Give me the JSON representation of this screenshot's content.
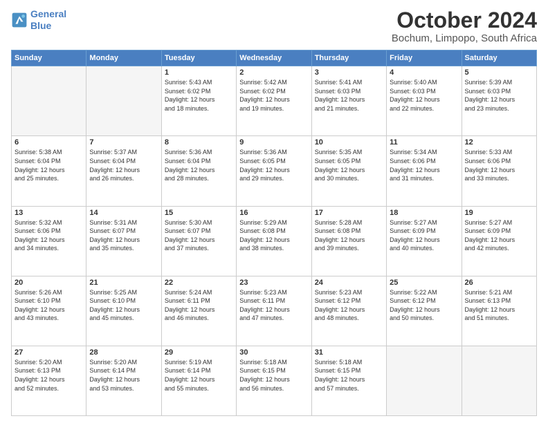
{
  "header": {
    "logo_line1": "General",
    "logo_line2": "Blue",
    "month": "October 2024",
    "location": "Bochum, Limpopo, South Africa"
  },
  "days_of_week": [
    "Sunday",
    "Monday",
    "Tuesday",
    "Wednesday",
    "Thursday",
    "Friday",
    "Saturday"
  ],
  "weeks": [
    [
      {
        "day": "",
        "content": ""
      },
      {
        "day": "",
        "content": ""
      },
      {
        "day": "1",
        "content": "Sunrise: 5:43 AM\nSunset: 6:02 PM\nDaylight: 12 hours\nand 18 minutes."
      },
      {
        "day": "2",
        "content": "Sunrise: 5:42 AM\nSunset: 6:02 PM\nDaylight: 12 hours\nand 19 minutes."
      },
      {
        "day": "3",
        "content": "Sunrise: 5:41 AM\nSunset: 6:03 PM\nDaylight: 12 hours\nand 21 minutes."
      },
      {
        "day": "4",
        "content": "Sunrise: 5:40 AM\nSunset: 6:03 PM\nDaylight: 12 hours\nand 22 minutes."
      },
      {
        "day": "5",
        "content": "Sunrise: 5:39 AM\nSunset: 6:03 PM\nDaylight: 12 hours\nand 23 minutes."
      }
    ],
    [
      {
        "day": "6",
        "content": "Sunrise: 5:38 AM\nSunset: 6:04 PM\nDaylight: 12 hours\nand 25 minutes."
      },
      {
        "day": "7",
        "content": "Sunrise: 5:37 AM\nSunset: 6:04 PM\nDaylight: 12 hours\nand 26 minutes."
      },
      {
        "day": "8",
        "content": "Sunrise: 5:36 AM\nSunset: 6:04 PM\nDaylight: 12 hours\nand 28 minutes."
      },
      {
        "day": "9",
        "content": "Sunrise: 5:36 AM\nSunset: 6:05 PM\nDaylight: 12 hours\nand 29 minutes."
      },
      {
        "day": "10",
        "content": "Sunrise: 5:35 AM\nSunset: 6:05 PM\nDaylight: 12 hours\nand 30 minutes."
      },
      {
        "day": "11",
        "content": "Sunrise: 5:34 AM\nSunset: 6:06 PM\nDaylight: 12 hours\nand 31 minutes."
      },
      {
        "day": "12",
        "content": "Sunrise: 5:33 AM\nSunset: 6:06 PM\nDaylight: 12 hours\nand 33 minutes."
      }
    ],
    [
      {
        "day": "13",
        "content": "Sunrise: 5:32 AM\nSunset: 6:06 PM\nDaylight: 12 hours\nand 34 minutes."
      },
      {
        "day": "14",
        "content": "Sunrise: 5:31 AM\nSunset: 6:07 PM\nDaylight: 12 hours\nand 35 minutes."
      },
      {
        "day": "15",
        "content": "Sunrise: 5:30 AM\nSunset: 6:07 PM\nDaylight: 12 hours\nand 37 minutes."
      },
      {
        "day": "16",
        "content": "Sunrise: 5:29 AM\nSunset: 6:08 PM\nDaylight: 12 hours\nand 38 minutes."
      },
      {
        "day": "17",
        "content": "Sunrise: 5:28 AM\nSunset: 6:08 PM\nDaylight: 12 hours\nand 39 minutes."
      },
      {
        "day": "18",
        "content": "Sunrise: 5:27 AM\nSunset: 6:09 PM\nDaylight: 12 hours\nand 40 minutes."
      },
      {
        "day": "19",
        "content": "Sunrise: 5:27 AM\nSunset: 6:09 PM\nDaylight: 12 hours\nand 42 minutes."
      }
    ],
    [
      {
        "day": "20",
        "content": "Sunrise: 5:26 AM\nSunset: 6:10 PM\nDaylight: 12 hours\nand 43 minutes."
      },
      {
        "day": "21",
        "content": "Sunrise: 5:25 AM\nSunset: 6:10 PM\nDaylight: 12 hours\nand 45 minutes."
      },
      {
        "day": "22",
        "content": "Sunrise: 5:24 AM\nSunset: 6:11 PM\nDaylight: 12 hours\nand 46 minutes."
      },
      {
        "day": "23",
        "content": "Sunrise: 5:23 AM\nSunset: 6:11 PM\nDaylight: 12 hours\nand 47 minutes."
      },
      {
        "day": "24",
        "content": "Sunrise: 5:23 AM\nSunset: 6:12 PM\nDaylight: 12 hours\nand 48 minutes."
      },
      {
        "day": "25",
        "content": "Sunrise: 5:22 AM\nSunset: 6:12 PM\nDaylight: 12 hours\nand 50 minutes."
      },
      {
        "day": "26",
        "content": "Sunrise: 5:21 AM\nSunset: 6:13 PM\nDaylight: 12 hours\nand 51 minutes."
      }
    ],
    [
      {
        "day": "27",
        "content": "Sunrise: 5:20 AM\nSunset: 6:13 PM\nDaylight: 12 hours\nand 52 minutes."
      },
      {
        "day": "28",
        "content": "Sunrise: 5:20 AM\nSunset: 6:14 PM\nDaylight: 12 hours\nand 53 minutes."
      },
      {
        "day": "29",
        "content": "Sunrise: 5:19 AM\nSunset: 6:14 PM\nDaylight: 12 hours\nand 55 minutes."
      },
      {
        "day": "30",
        "content": "Sunrise: 5:18 AM\nSunset: 6:15 PM\nDaylight: 12 hours\nand 56 minutes."
      },
      {
        "day": "31",
        "content": "Sunrise: 5:18 AM\nSunset: 6:15 PM\nDaylight: 12 hours\nand 57 minutes."
      },
      {
        "day": "",
        "content": ""
      },
      {
        "day": "",
        "content": ""
      }
    ]
  ]
}
